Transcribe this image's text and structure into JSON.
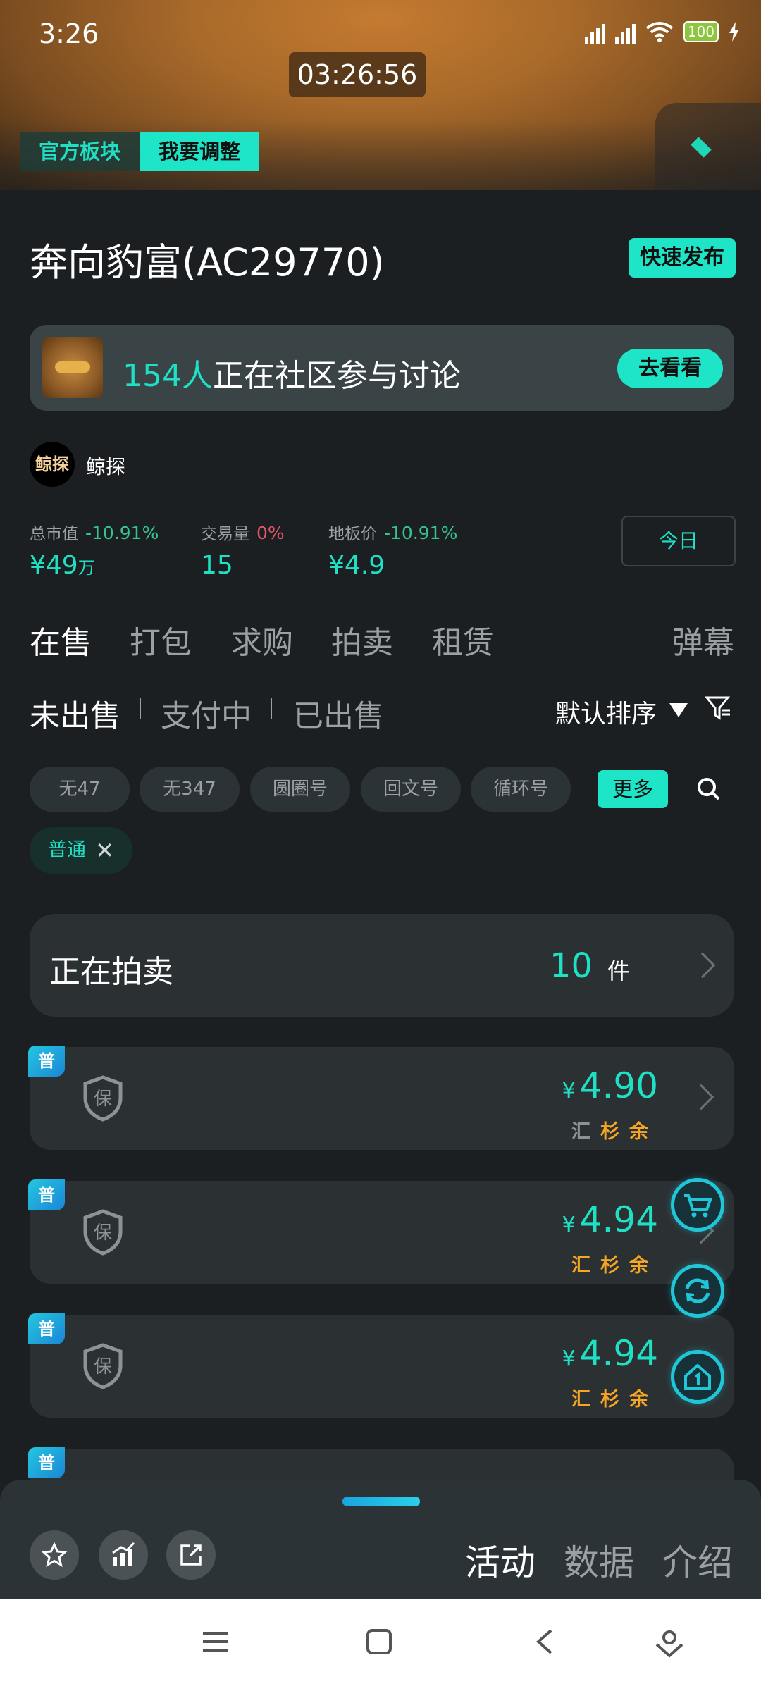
{
  "status": {
    "time": "3:26",
    "battery": "100"
  },
  "banner": {
    "timer": "03:26:56",
    "official_label": "官方板块",
    "adjust_label": "我要调整"
  },
  "header": {
    "title": "奔向豹富(AC29770)",
    "quick_publish": "快速发布"
  },
  "community": {
    "count": "154人",
    "text": "正在社区参与讨论",
    "go_label": "去看看"
  },
  "author": {
    "avatar_text": "鲸探",
    "name": "鲸探"
  },
  "stats": {
    "market_cap": {
      "label": "总市值",
      "change": "-10.91%",
      "value": "¥49",
      "unit": "万"
    },
    "volume": {
      "label": "交易量",
      "change": "0%",
      "value": "15"
    },
    "floor": {
      "label": "地板价",
      "change": "-10.91%",
      "value": "¥4.9"
    },
    "period": "今日"
  },
  "main_tabs": [
    "在售",
    "打包",
    "求购",
    "拍卖",
    "租赁"
  ],
  "danmu": "弹幕",
  "sub_tabs": [
    "未出售",
    "支付中",
    "已出售"
  ],
  "sort_label": "默认排序",
  "chips": [
    "无47",
    "无347",
    "圆圈号",
    "回文号",
    "循环号"
  ],
  "more_label": "更多",
  "selected_filter": "普通",
  "auction": {
    "label": "正在拍卖",
    "count": "10",
    "unit": "件"
  },
  "items": [
    {
      "badge": "普",
      "shield": "保",
      "currency": "¥",
      "price": "4.90",
      "tags": [
        "汇",
        "杉",
        "余"
      ],
      "tag_colors": [
        "gray",
        "orange",
        "orange"
      ]
    },
    {
      "badge": "普",
      "shield": "保",
      "currency": "¥",
      "price": "4.94",
      "tags": [
        "汇",
        "杉",
        "余"
      ],
      "tag_colors": [
        "orange",
        "orange",
        "orange"
      ]
    },
    {
      "badge": "普",
      "shield": "保",
      "currency": "¥",
      "price": "4.94",
      "tags": [
        "汇",
        "杉",
        "余"
      ],
      "tag_colors": [
        "orange",
        "orange",
        "orange"
      ]
    },
    {
      "badge": "普"
    }
  ],
  "bottom_tabs": [
    "活动",
    "数据",
    "介绍"
  ],
  "colors": {
    "accent": "#1fe5c8",
    "background": "#1b1f22",
    "card": "#2b3033",
    "orange": "#f5a623"
  }
}
